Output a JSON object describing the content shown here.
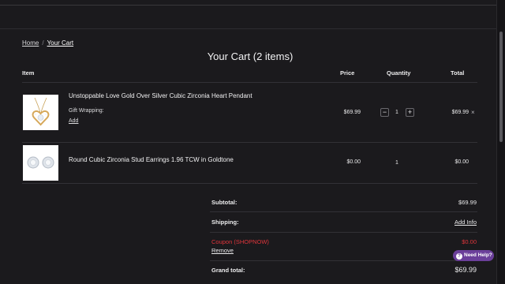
{
  "breadcrumb": {
    "home": "Home",
    "separator": "/",
    "current": "Your Cart"
  },
  "page_title": "Your Cart (2 items)",
  "table_headers": {
    "item": "Item",
    "price": "Price",
    "quantity": "Quantity",
    "total": "Total"
  },
  "items": [
    {
      "name": "Unstoppable Love Gold Over Silver Cubic Zirconia Heart Pendant",
      "image_icon": "heart-pendant-image",
      "gift_wrapping_label": "Gift Wrapping:",
      "gift_wrapping_action": "Add",
      "price": "$69.99",
      "quantity": "1",
      "total": "$69.99",
      "remove_icon": "×"
    },
    {
      "name": "Round Cubic Zirconia Stud Earrings 1.96 TCW in Goldtone",
      "image_icon": "stud-earrings-image",
      "price": "$0.00",
      "quantity": "1",
      "total": "$0.00"
    }
  ],
  "qty_controls": {
    "minus": "−",
    "plus": "+"
  },
  "summary": {
    "subtotal_label": "Subtotal:",
    "subtotal_value": "$69.99",
    "shipping_label": "Shipping:",
    "shipping_action": "Add Info",
    "coupon_label": "Coupon (SHOPNOW)",
    "coupon_value": "$0.00",
    "coupon_remove": "Remove",
    "grand_total_label": "Grand total:",
    "grand_total_value": "$69.99"
  },
  "help": {
    "icon": "?",
    "label": "Need Help?"
  },
  "colors": {
    "background": "#1b1a1d",
    "coupon_red": "#e0353b",
    "help_purple": "#6b3f9a"
  }
}
